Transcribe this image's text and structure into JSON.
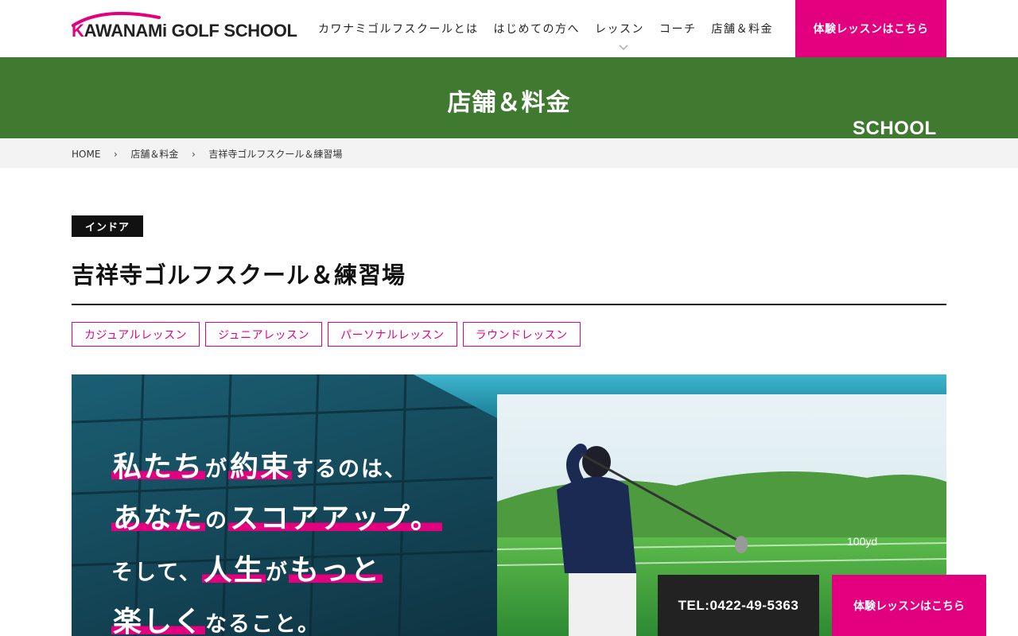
{
  "brand": {
    "logo_text": "KAWANAMi GOLF SCHOOL",
    "logo_initial": "K",
    "logo_rest": "AWANAMi GOLF SCHOOL",
    "accent": "#e3007f",
    "green": "#3f7a30"
  },
  "nav": {
    "items": [
      {
        "label": "カワナミゴルフスクールとは"
      },
      {
        "label": "はじめての方へ"
      },
      {
        "label": "レッスン"
      },
      {
        "label": "コーチ"
      },
      {
        "label": "店舗＆料金"
      }
    ],
    "trial_label": "体験レッスンはこちら"
  },
  "banner": {
    "title": "店舗＆料金",
    "subtitle_en": "SCHOOL"
  },
  "breadcrumb": [
    {
      "label": "HOME"
    },
    {
      "label": "店舗＆料金"
    },
    {
      "label": "吉祥寺ゴルフスクール＆練習場"
    }
  ],
  "school": {
    "tag": "インドア",
    "title": "吉祥寺ゴルフスクール＆練習場",
    "lessons": [
      {
        "label": "カジュアルレッスン"
      },
      {
        "label": "ジュニアレッスン"
      },
      {
        "label": "パーソナルレッスン"
      },
      {
        "label": "ラウンドレッスン"
      }
    ]
  },
  "hero": {
    "line1": {
      "a": "私たち",
      "b": "が",
      "c": "約束",
      "d": "するのは、"
    },
    "line2": {
      "a": "あなた",
      "b": "の",
      "c": "スコアアップ。"
    },
    "line3": {
      "a": "そして、",
      "b": "人生",
      "c": "が",
      "d": "もっと"
    },
    "line4": {
      "a": "楽しく",
      "b": "なること。"
    },
    "screen_label": "100yd"
  },
  "cta": {
    "tel": "TEL:0422-49-5363",
    "trial": "体験レッスンはこちら"
  }
}
